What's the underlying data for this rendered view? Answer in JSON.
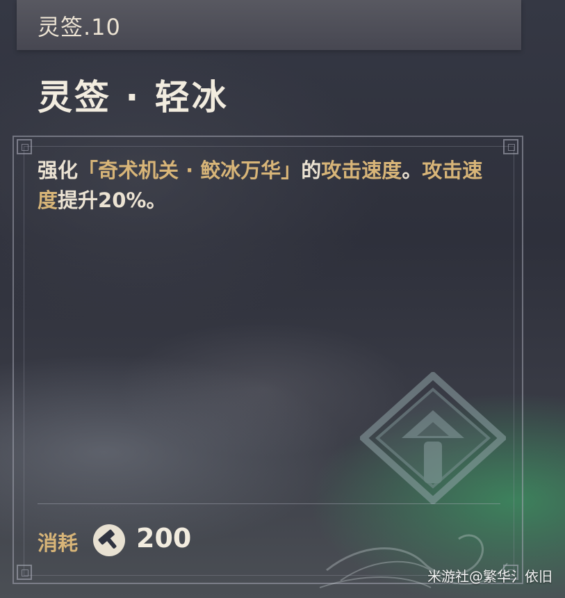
{
  "header": {
    "level": "灵签.10"
  },
  "item": {
    "title": "灵签 · 轻冰"
  },
  "description": {
    "part1": "强化",
    "part2": "「奇术机关 · 鲛冰万华」",
    "part3": "的",
    "part4": "攻击速度",
    "part5": "。",
    "part6": "攻击速度",
    "part7": "提升20%。"
  },
  "cost": {
    "label": "消耗",
    "icon": "hammer-icon",
    "value": "200"
  },
  "watermark": {
    "text": "米游社@繁华氵依旧"
  },
  "colors": {
    "highlight": "#d8b578",
    "text": "#ece3d3"
  }
}
